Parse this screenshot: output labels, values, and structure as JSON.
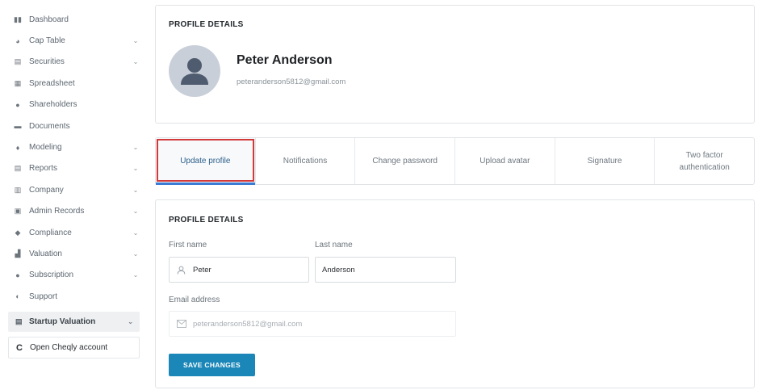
{
  "sidebar": {
    "items": [
      {
        "label": "Dashboard",
        "icon": "dashboard-icon",
        "glyph": "▮▮",
        "has_chevron": false
      },
      {
        "label": "Cap Table",
        "icon": "pie-chart-icon",
        "glyph": "◕",
        "has_chevron": true
      },
      {
        "label": "Securities",
        "icon": "clipboard-icon",
        "glyph": "▤",
        "has_chevron": true
      },
      {
        "label": "Spreadsheet",
        "icon": "grid-icon",
        "glyph": "▦",
        "has_chevron": false
      },
      {
        "label": "Shareholders",
        "icon": "person-icon",
        "glyph": "●",
        "has_chevron": false
      },
      {
        "label": "Documents",
        "icon": "folder-icon",
        "glyph": "▬",
        "has_chevron": false
      },
      {
        "label": "Modeling",
        "icon": "bulb-icon",
        "glyph": "♦",
        "has_chevron": true
      },
      {
        "label": "Reports",
        "icon": "report-icon",
        "glyph": "▤",
        "has_chevron": true
      },
      {
        "label": "Company",
        "icon": "building-icon",
        "glyph": "▥",
        "has_chevron": true
      },
      {
        "label": "Admin Records",
        "icon": "records-icon",
        "glyph": "▣",
        "has_chevron": true
      },
      {
        "label": "Compliance",
        "icon": "shield-icon",
        "glyph": "◆",
        "has_chevron": true
      },
      {
        "label": "Valuation",
        "icon": "bar-chart-icon",
        "glyph": "▟",
        "has_chevron": true
      },
      {
        "label": "Subscription",
        "icon": "dollar-icon",
        "glyph": "●",
        "has_chevron": true
      },
      {
        "label": "Support",
        "icon": "support-icon",
        "glyph": "◐",
        "has_chevron": false
      }
    ],
    "chevron_glyph": "⌄",
    "startup_valuation": {
      "label": "Startup Valuation",
      "glyph": "▤"
    },
    "cheqly": {
      "label": "Open Cheqly account",
      "glyph": "C"
    }
  },
  "profile": {
    "title": "PROFILE DETAILS",
    "name": "Peter Anderson",
    "email": "peteranderson5812@gmail.com"
  },
  "tabs": [
    {
      "label": "Update profile",
      "active": true
    },
    {
      "label": "Notifications",
      "active": false
    },
    {
      "label": "Change password",
      "active": false
    },
    {
      "label": "Upload avatar",
      "active": false
    },
    {
      "label": "Signature",
      "active": false
    },
    {
      "label": "Two factor authentication",
      "active": false
    }
  ],
  "form": {
    "title": "PROFILE DETAILS",
    "first_name_label": "First name",
    "first_name_value": "Peter",
    "last_name_label": "Last name",
    "last_name_value": "Anderson",
    "email_label": "Email address",
    "email_value": "peteranderson5812@gmail.com",
    "save_label": "SAVE CHANGES"
  },
  "colors": {
    "accent": "#1a87b8",
    "active_tab_underline": "#3a7bd5",
    "highlight_border": "#d23a3a"
  }
}
